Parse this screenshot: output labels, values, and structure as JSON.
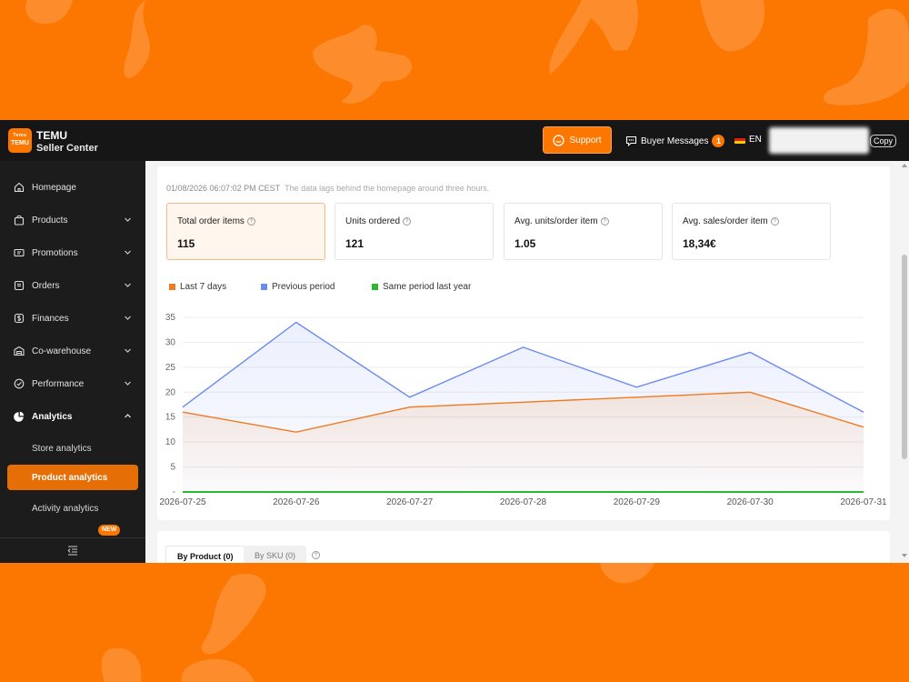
{
  "brand": {
    "logo_line1": "Temu",
    "logo_line2": "TEMU",
    "name": "TEMU",
    "subtitle": "Seller Center",
    "color": "#fb7701"
  },
  "header": {
    "support_label": "Support",
    "support_icon": "chat-bubble-icon",
    "buyer_messages_label": "Buyer Messages",
    "buyer_messages_count": "1",
    "language_label": "EN",
    "language_flag": "germany-flag-icon",
    "copy_label": "Copy"
  },
  "sidebar": {
    "items": [
      {
        "label": "Homepage",
        "icon": "home-icon",
        "has_chevron": false
      },
      {
        "label": "Products",
        "icon": "bag-icon",
        "has_chevron": true
      },
      {
        "label": "Promotions",
        "icon": "ticket-icon",
        "has_chevron": true
      },
      {
        "label": "Orders",
        "icon": "document-icon",
        "has_chevron": true
      },
      {
        "label": "Finances",
        "icon": "dollar-icon",
        "has_chevron": true
      },
      {
        "label": "Co-warehouse",
        "icon": "warehouse-icon",
        "has_chevron": true
      },
      {
        "label": "Performance",
        "icon": "gauge-icon",
        "has_chevron": true
      },
      {
        "label": "Analytics",
        "icon": "pie-chart-icon",
        "has_chevron": true,
        "expanded": true
      }
    ],
    "sub_items": [
      {
        "label": "Store analytics"
      },
      {
        "label": "Product analytics",
        "selected": true
      },
      {
        "label": "Activity analytics"
      }
    ],
    "new_badge": "NEW",
    "collapse_icon": "collapse-menu-icon"
  },
  "summary": {
    "timestamp": "01/08/2026 06:07:02 PM CEST",
    "note": "The data lags behind the homepage around three hours.",
    "metrics": [
      {
        "label": "Total order items",
        "value": "115",
        "selected": true
      },
      {
        "label": "Units ordered",
        "value": "121"
      },
      {
        "label": "Avg. units/order item",
        "value": "1.05"
      },
      {
        "label": "Avg. sales/order item",
        "value": "18,34€"
      }
    ]
  },
  "chart_data": {
    "type": "area",
    "categories": [
      "2026-07-25",
      "2026-07-26",
      "2026-07-27",
      "2026-07-28",
      "2026-07-29",
      "2026-07-30",
      "2026-07-31"
    ],
    "y_ticks": [
      "35",
      "30",
      "25",
      "20",
      "15",
      "10",
      "5",
      "-"
    ],
    "ylim": [
      0,
      35
    ],
    "grid": true,
    "legend_position": "top-left",
    "series": [
      {
        "name": "Last 7 days",
        "color": "#f07a1f",
        "values": [
          16,
          12,
          17,
          18,
          19,
          20,
          13
        ]
      },
      {
        "name": "Previous period",
        "color": "#6b8cef",
        "values": [
          17,
          34,
          19,
          29,
          21,
          28,
          16
        ]
      },
      {
        "name": "Same period last year",
        "color": "#2bb934",
        "values": [
          0,
          0,
          0,
          0,
          0,
          0,
          0
        ]
      }
    ]
  },
  "tabs": {
    "by_product": "By Product (0)",
    "by_sku": "By SKU (0)"
  }
}
